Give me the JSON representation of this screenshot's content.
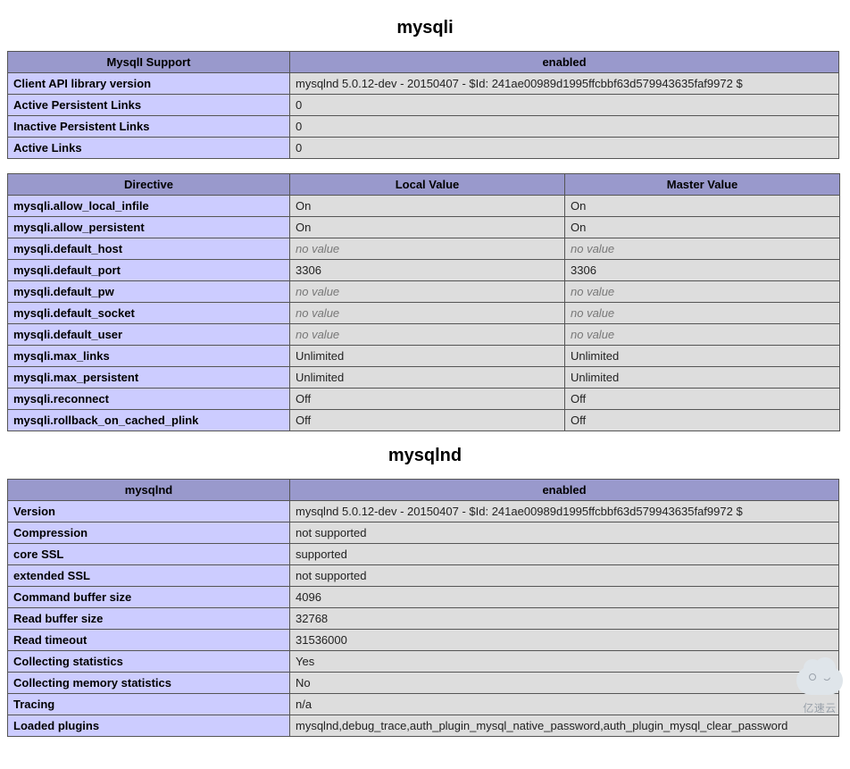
{
  "sections": [
    {
      "title": "mysqli",
      "tables": [
        {
          "headers": [
            "MysqlI Support",
            "enabled"
          ],
          "col_widths": [
            "316px",
            "auto"
          ],
          "rows": [
            {
              "key": "Client API library version",
              "vals": [
                "mysqlnd 5.0.12-dev - 20150407 - $Id: 241ae00989d1995ffcbbf63d579943635faf9972 $"
              ]
            },
            {
              "key": "Active Persistent Links",
              "vals": [
                "0"
              ]
            },
            {
              "key": "Inactive Persistent Links",
              "vals": [
                "0"
              ]
            },
            {
              "key": "Active Links",
              "vals": [
                "0"
              ]
            }
          ]
        },
        {
          "headers": [
            "Directive",
            "Local Value",
            "Master Value"
          ],
          "col_widths": [
            "316px",
            "308px",
            "308px"
          ],
          "rows": [
            {
              "key": "mysqli.allow_local_infile",
              "vals": [
                "On",
                "On"
              ]
            },
            {
              "key": "mysqli.allow_persistent",
              "vals": [
                "On",
                "On"
              ]
            },
            {
              "key": "mysqli.default_host",
              "vals": [
                null,
                null
              ]
            },
            {
              "key": "mysqli.default_port",
              "vals": [
                "3306",
                "3306"
              ]
            },
            {
              "key": "mysqli.default_pw",
              "vals": [
                null,
                null
              ]
            },
            {
              "key": "mysqli.default_socket",
              "vals": [
                null,
                null
              ]
            },
            {
              "key": "mysqli.default_user",
              "vals": [
                null,
                null
              ]
            },
            {
              "key": "mysqli.max_links",
              "vals": [
                "Unlimited",
                "Unlimited"
              ]
            },
            {
              "key": "mysqli.max_persistent",
              "vals": [
                "Unlimited",
                "Unlimited"
              ]
            },
            {
              "key": "mysqli.reconnect",
              "vals": [
                "Off",
                "Off"
              ]
            },
            {
              "key": "mysqli.rollback_on_cached_plink",
              "vals": [
                "Off",
                "Off"
              ]
            }
          ]
        }
      ]
    },
    {
      "title": "mysqlnd",
      "tables": [
        {
          "headers": [
            "mysqlnd",
            "enabled"
          ],
          "col_widths": [
            "316px",
            "auto"
          ],
          "rows": [
            {
              "key": "Version",
              "vals": [
                "mysqlnd 5.0.12-dev - 20150407 - $Id: 241ae00989d1995ffcbbf63d579943635faf9972 $"
              ]
            },
            {
              "key": "Compression",
              "vals": [
                "not supported"
              ]
            },
            {
              "key": "core SSL",
              "vals": [
                "supported"
              ]
            },
            {
              "key": "extended SSL",
              "vals": [
                "not supported"
              ]
            },
            {
              "key": "Command buffer size",
              "vals": [
                "4096"
              ]
            },
            {
              "key": "Read buffer size",
              "vals": [
                "32768"
              ]
            },
            {
              "key": "Read timeout",
              "vals": [
                "31536000"
              ]
            },
            {
              "key": "Collecting statistics",
              "vals": [
                "Yes"
              ]
            },
            {
              "key": "Collecting memory statistics",
              "vals": [
                "No"
              ]
            },
            {
              "key": "Tracing",
              "vals": [
                "n/a"
              ]
            },
            {
              "key": "Loaded plugins",
              "vals": [
                "mysqlnd,debug_trace,auth_plugin_mysql_native_password,auth_plugin_mysql_clear_password"
              ]
            }
          ]
        }
      ]
    }
  ],
  "no_value_text": "no value",
  "brand": "亿速云"
}
